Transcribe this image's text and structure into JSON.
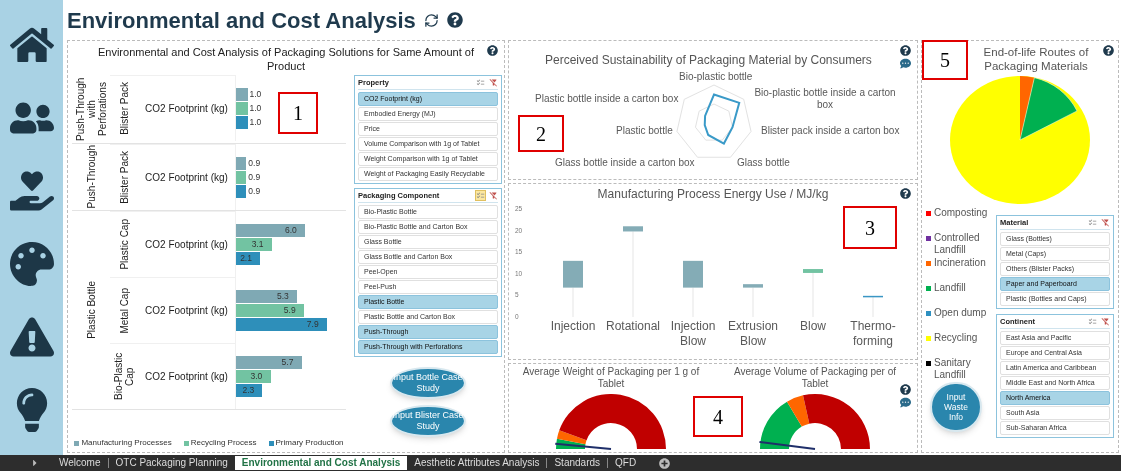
{
  "header": {
    "title": "Environmental and Cost Analysis"
  },
  "cost_panel": {
    "title": "Environmental and Cost Analysis of Packaging Solutions for Same Amount of Product",
    "groups": [
      {
        "label": "Push-Through with Perforations",
        "rows": [
          {
            "property": "CO2 Footprint (kg)"
          }
        ]
      },
      {
        "label": "Push-Through",
        "rows": [
          {
            "property": "CO2 Footprint (kg)"
          }
        ]
      },
      {
        "label": "Plastic Bottle",
        "rows": [
          {
            "property": "CO2 Footprint (kg)"
          },
          {
            "property": "CO2 Footprint (kg)"
          },
          {
            "property": "CO2 Footprint (kg)"
          }
        ]
      }
    ],
    "chart_data": {
      "type": "bar",
      "orientation": "horizontal",
      "grid": true,
      "categories": [
        "Blister Pack",
        "Blister Pack",
        "Plastic Cap",
        "Metal Cap",
        "Bio-Plastic Cap"
      ],
      "series": [
        {
          "name": "Manufacturing Processes",
          "color": "#7fa9b4",
          "values": [
            1.0,
            0.9,
            6.0,
            5.3,
            5.7
          ],
          "value_labels": [
            "1.0",
            "0.9",
            "6.0",
            "5.3",
            "5.7"
          ]
        },
        {
          "name": "Recycling Process",
          "color": "#72c3a2",
          "values": [
            1.0,
            0.9,
            3.1,
            5.9,
            3.0
          ],
          "value_labels": [
            "1.0",
            "0.9",
            "3.1",
            "5.9",
            "3.0"
          ]
        },
        {
          "name": "Primary Production",
          "color": "#2e8fba",
          "values": [
            1.0,
            0.9,
            2.1,
            7.9,
            2.3
          ],
          "value_labels": [
            "1.0",
            "0.9",
            "2.1",
            "7.9",
            "2.3"
          ]
        }
      ]
    },
    "slicers": [
      {
        "title": "Property",
        "multi_select": false,
        "items": [
          {
            "label": "CO2 Footprint (kg)",
            "selected": true
          },
          {
            "label": "Embodied Energy (MJ)",
            "selected": false
          },
          {
            "label": "Price",
            "selected": false
          },
          {
            "label": "Volume Comparison with 1g of Tablet",
            "selected": false
          },
          {
            "label": "Weight Comparison with 1g of Tablet",
            "selected": false
          },
          {
            "label": "Weight of Packaging Easily Recyclable",
            "selected": false
          }
        ]
      },
      {
        "title": "Packaging Component",
        "multi_select": true,
        "items": [
          {
            "label": "Bio-Plastic Bottle",
            "selected": false
          },
          {
            "label": "Bio-Plastic Bottle and Carton Box",
            "selected": false
          },
          {
            "label": "Glass Bottle",
            "selected": false
          },
          {
            "label": "Glass Bottle and Carton Box",
            "selected": false
          },
          {
            "label": "Peel-Open",
            "selected": false
          },
          {
            "label": "Peel-Push",
            "selected": false
          },
          {
            "label": "Plastic Bottle",
            "selected": true
          },
          {
            "label": "Plastic Bottle and Carton Box",
            "selected": false
          },
          {
            "label": "Push-Through",
            "selected": true
          },
          {
            "label": "Push-Through with Perforations",
            "selected": true
          }
        ]
      }
    ],
    "buttons": [
      "Input Bottle Case Study",
      "Input Blister Case Study"
    ]
  },
  "sustainability_panel": {
    "title": "Perceived Sustainability of Packaging Material by Consumers",
    "axes": [
      "Bio-plastic bottle",
      "Plastic bottle inside a carton box",
      "Bio-plastic bottle inside a carton box",
      "Plastic bottle",
      "Blister pack inside a carton box",
      "Glass bottle inside a carton box",
      "Glass bottle"
    ]
  },
  "energy_panel": {
    "title": "Manufacturing Process Energy Use / MJ/kg",
    "chart_data": {
      "type": "bar",
      "stacked": true,
      "categories": [
        "Injection",
        "Rotational",
        "Injection Blow",
        "Extrusion Blow",
        "Blow",
        "Thermo-forming"
      ],
      "ylim": [
        0,
        25
      ],
      "yticks": [
        0,
        5,
        10,
        15,
        20,
        25
      ],
      "series": [
        {
          "color": "#eeeeee",
          "values": [
            6.8,
            19.8,
            6.8,
            6.8,
            10.2,
            4.6
          ]
        },
        {
          "color": "#84acb6",
          "values": [
            6.2,
            1.2,
            6.2,
            0.8,
            null,
            null
          ]
        },
        {
          "color": "#72c3a2",
          "values": [
            null,
            null,
            null,
            null,
            0.9,
            null
          ]
        },
        {
          "color": "#3a96c4",
          "values": [
            null,
            null,
            null,
            null,
            null,
            0.3
          ]
        }
      ]
    }
  },
  "gauges_panel": {
    "gauges": [
      {
        "title": "Average Weight of Packaging per 1 g of Tablet"
      },
      {
        "title": "Average Volume of Packaging per of Tablet"
      }
    ]
  },
  "end_of_life_panel": {
    "title": "End-of-life Routes of Packaging Materials",
    "legend": [
      {
        "label": "Composting",
        "color": "#ff0000"
      },
      {
        "label": "Controlled Landfill",
        "color": "#7030a0"
      },
      {
        "label": "Incineration",
        "color": "#ff6600"
      },
      {
        "label": "Landfill",
        "color": "#00b050"
      },
      {
        "label": "Open dump",
        "color": "#2e90c0"
      },
      {
        "label": "Recycling",
        "color": "#ffff00"
      },
      {
        "label": "Sanitary Landfill",
        "color": "#000000"
      }
    ],
    "slicers": [
      {
        "title": "Material",
        "multi_select": false,
        "items": [
          {
            "label": "Glass (Bottles)",
            "selected": false
          },
          {
            "label": "Metal (Caps)",
            "selected": false
          },
          {
            "label": "Others (Blister Packs)",
            "selected": false
          },
          {
            "label": "Paper and Paperboard",
            "selected": true
          },
          {
            "label": "Plastic (Bottles and Caps)",
            "selected": false
          }
        ]
      },
      {
        "title": "Continent",
        "multi_select": false,
        "items": [
          {
            "label": "East Asia and Pacific",
            "selected": false
          },
          {
            "label": "Europe and Central Asia",
            "selected": false
          },
          {
            "label": "Latin America and Caribbean",
            "selected": false
          },
          {
            "label": "Middle East and North Africa",
            "selected": false
          },
          {
            "label": "North America",
            "selected": true
          },
          {
            "label": "South Asia",
            "selected": false
          },
          {
            "label": "Sub-Saharan Africa",
            "selected": false
          }
        ]
      }
    ],
    "button": "Input Waste Info"
  },
  "callouts": [
    {
      "label": "1"
    },
    {
      "label": "2"
    },
    {
      "label": "3"
    },
    {
      "label": "4"
    },
    {
      "label": "5"
    }
  ],
  "tabs": [
    {
      "label": "Welcome",
      "selected": false
    },
    {
      "label": "OTC Packaging Planning",
      "selected": false
    },
    {
      "label": "Environmental and Cost Analysis",
      "selected": true
    },
    {
      "label": "Aesthetic Attributes Analysis",
      "selected": false
    },
    {
      "label": "Standards",
      "selected": false
    },
    {
      "label": "QFD",
      "selected": false
    }
  ]
}
